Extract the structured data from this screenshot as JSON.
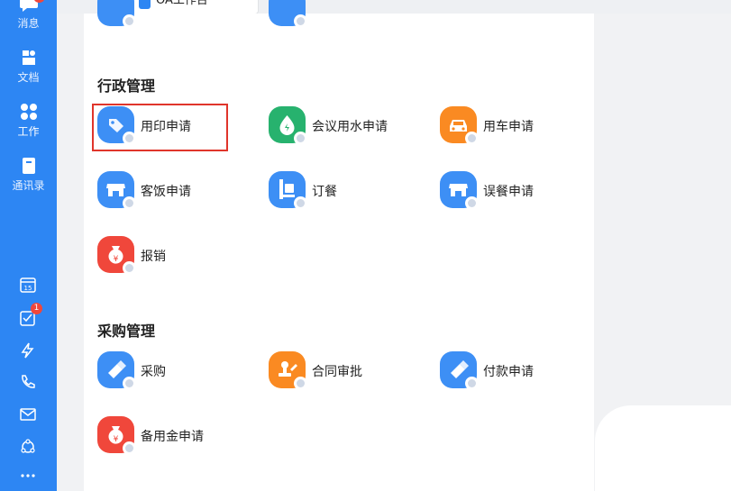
{
  "nav": {
    "items": [
      {
        "label": "消息",
        "icon": "chat-icon"
      },
      {
        "label": "文档",
        "icon": "document-icon"
      },
      {
        "label": "工作",
        "icon": "apps-grid-icon"
      },
      {
        "label": "通讯录",
        "icon": "contacts-book-icon"
      }
    ],
    "tools": [
      {
        "icon": "calendar-icon",
        "text": "15"
      },
      {
        "icon": "task-check-icon",
        "badge": "1"
      },
      {
        "icon": "lightning-icon"
      },
      {
        "icon": "phone-icon"
      },
      {
        "icon": "mail-icon"
      },
      {
        "icon": "network-icon"
      },
      {
        "icon": "more-icon"
      }
    ]
  },
  "tab": {
    "label": "OA工作台"
  },
  "sections": [
    {
      "title": "行政管理",
      "apps": [
        {
          "label": "用印申请",
          "icon": "seal-tag-icon",
          "color": "#3d8ff5"
        },
        {
          "label": "会议用水申请",
          "icon": "water-drop-icon",
          "color": "#27b26e"
        },
        {
          "label": "用车申请",
          "icon": "car-icon",
          "color": "#fa8a22"
        },
        {
          "label": "客饭申请",
          "icon": "shop-icon",
          "color": "#3d8ff5"
        },
        {
          "label": "订餐",
          "icon": "food-tray-icon",
          "color": "#3d8ff5"
        },
        {
          "label": "误餐申请",
          "icon": "shop-icon",
          "color": "#3d8ff5"
        },
        {
          "label": "报销",
          "icon": "money-bag-icon",
          "color": "#f0473b"
        }
      ]
    },
    {
      "title": "采购管理",
      "apps": [
        {
          "label": "采购",
          "icon": "brush-icon",
          "color": "#3d8ff5"
        },
        {
          "label": "合同审批",
          "icon": "contract-stamp-icon",
          "color": "#fa8a22"
        },
        {
          "label": "付款申请",
          "icon": "brush-icon",
          "color": "#3d8ff5"
        },
        {
          "label": "备用金申请",
          "icon": "money-bag-icon",
          "color": "#f0473b"
        }
      ]
    }
  ]
}
